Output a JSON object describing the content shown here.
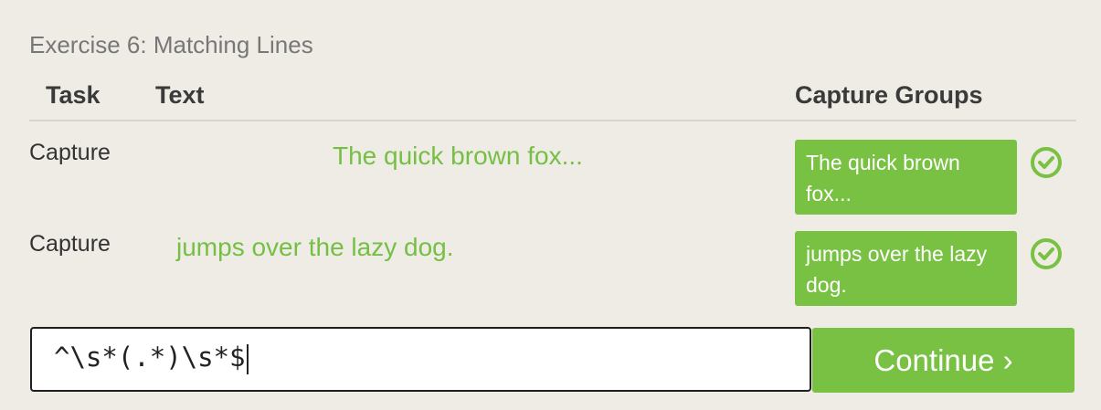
{
  "exercise": {
    "title": "Exercise 6: Matching Lines"
  },
  "table": {
    "headers": {
      "task": "Task",
      "text": "Text",
      "capture_groups": "Capture Groups"
    },
    "rows": [
      {
        "task": "Capture",
        "text": "The quick brown fox...",
        "capture_group": "The quick brown fox...",
        "status": "check-icon"
      },
      {
        "task": "Capture",
        "text": "jumps over the lazy dog.",
        "capture_group": "jumps over the lazy dog.",
        "status": "check-icon"
      }
    ]
  },
  "input": {
    "value": "^\\s*(.*)\\s*$"
  },
  "continue_button": {
    "label": "Continue ›"
  },
  "colors": {
    "accent": "#79c143",
    "match_text": "#76bf45",
    "background": "#efece6"
  }
}
